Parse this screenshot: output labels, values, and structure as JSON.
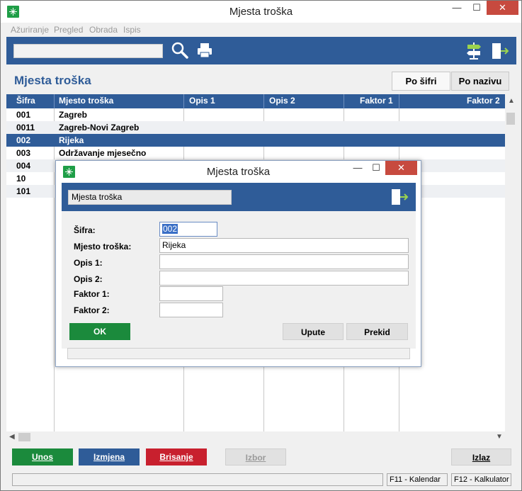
{
  "window": {
    "title": "Mjesta troška",
    "min": "—",
    "max": "☐",
    "close": "✕"
  },
  "menu": [
    "Ažuriranje",
    "Pregled",
    "Obrada",
    "Ispis"
  ],
  "toolbar": {
    "search_placeholder": "",
    "icons": [
      "search-icon",
      "printer-icon",
      "signpost-icon",
      "exit-icon"
    ]
  },
  "page": {
    "title": "Mjesta troška"
  },
  "sort": {
    "by_code": "Po šifri",
    "by_name": "Po nazivu"
  },
  "grid": {
    "columns": [
      "Šifra",
      "Mjesto troška",
      "Opis 1",
      "Opis 2",
      "Faktor 1",
      "Faktor 2"
    ],
    "rows": [
      {
        "sifra": "001",
        "naziv": "Zagreb"
      },
      {
        "sifra": "0011",
        "naziv": "Zagreb-Novi Zagreb"
      },
      {
        "sifra": "002",
        "naziv": "Rijeka"
      },
      {
        "sifra": "003",
        "naziv": "Održavanje mjesečno"
      },
      {
        "sifra": "004",
        "naziv": ""
      },
      {
        "sifra": "10",
        "naziv": ""
      },
      {
        "sifra": "101",
        "naziv": ""
      }
    ],
    "selected_row": 2
  },
  "buttons": {
    "unos": "Unos",
    "izmjena": "Izmjena",
    "brisanje": "Brisanje",
    "izbor": "Izbor",
    "izlaz": "Izlaz"
  },
  "status": {
    "f11": "F11 - Kalendar",
    "f12": "F12 - Kalkulator"
  },
  "dialog": {
    "title": "Mjesta troška",
    "banner_label": "Mjesta troška",
    "fields": {
      "sifra_label": "Šifra:",
      "sifra_value": "002",
      "mjesto_label": "Mjesto troška:",
      "mjesto_value": "Rijeka",
      "opis1_label": "Opis 1:",
      "opis1_value": "",
      "opis2_label": "Opis 2:",
      "opis2_value": "",
      "faktor1_label": "Faktor 1:",
      "faktor1_value": "",
      "faktor2_label": "Faktor 2:",
      "faktor2_value": ""
    },
    "ok": "OK",
    "upute": "Upute",
    "prekid": "Prekid"
  },
  "colors": {
    "accent": "#2f5c98",
    "green": "#1b8a3c",
    "red": "#c8202e"
  }
}
